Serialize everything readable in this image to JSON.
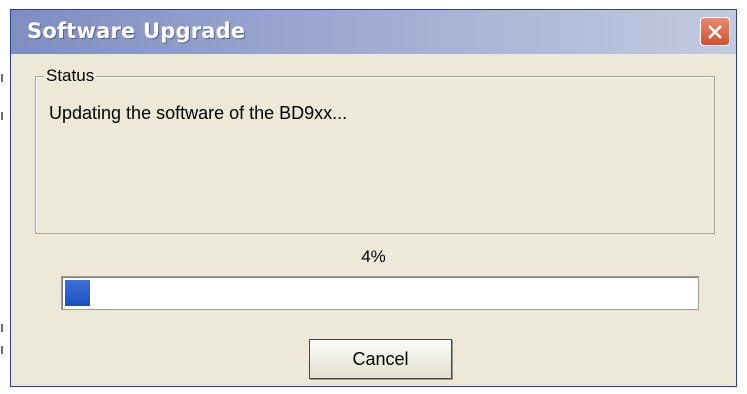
{
  "window": {
    "title": "Software Upgrade"
  },
  "status_group": {
    "legend": "Status",
    "message": "Updating the software of the BD9xx..."
  },
  "progress": {
    "label": "4%",
    "value": 0.04
  },
  "buttons": {
    "cancel_label": "Cancel"
  },
  "icons": {
    "close": "close-icon"
  },
  "colors": {
    "progress_fill": "#2a5ccc",
    "close_button": "#d9603f"
  }
}
